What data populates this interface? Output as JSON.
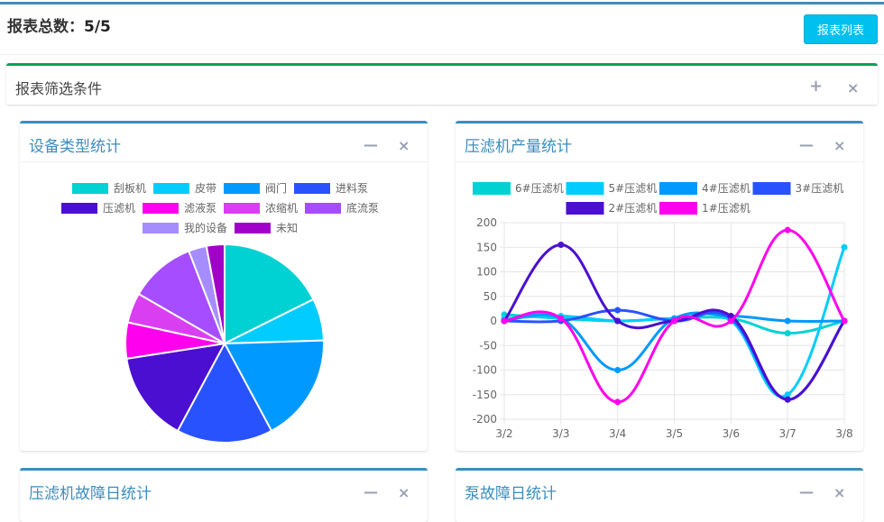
{
  "header": {
    "title_prefix": "报表总数：",
    "count": "5/5",
    "list_button": "报表列表"
  },
  "filter": {
    "title": "报表筛选条件",
    "expand_symbol": "+",
    "close_symbol": "×"
  },
  "panels": {
    "device_type": {
      "title": "设备类型统计",
      "minimize_symbol": "—",
      "close_symbol": "×"
    },
    "press_output": {
      "title": "压滤机产量统计",
      "minimize_symbol": "—",
      "close_symbol": "×"
    },
    "press_fault": {
      "title": "压滤机故障日统计",
      "minimize_symbol": "—",
      "close_symbol": "×"
    },
    "pump_fault": {
      "title": "泵故障日统计",
      "minimize_symbol": "—",
      "close_symbol": "×"
    }
  },
  "chart_data": [
    {
      "type": "pie",
      "labels": [
        "刮板机",
        "皮带",
        "阀门",
        "进料泵",
        "压滤机",
        "滤液泵",
        "浓缩机",
        "底流泵",
        "我的设备",
        "未知"
      ],
      "values": [
        18,
        7,
        18,
        16,
        15,
        6,
        5,
        11,
        3,
        3
      ],
      "colors": [
        "#00d2d3",
        "#00ccff",
        "#0099ff",
        "#2952ff",
        "#4b0fd2",
        "#ff00ee",
        "#d93ff0",
        "#a64dff",
        "#a58cff",
        "#a000c8"
      ],
      "legend": "top"
    },
    {
      "type": "line",
      "x": [
        "3/2",
        "3/3",
        "3/4",
        "3/5",
        "3/6",
        "3/7",
        "3/8"
      ],
      "ylim": [
        -200,
        200
      ],
      "yticks": [
        200,
        150,
        100,
        50,
        0,
        -50,
        -100,
        -150,
        -200
      ],
      "legend": "top",
      "grid": true,
      "series": [
        {
          "name": "6#压滤机",
          "color": "#00d2d3",
          "values": [
            13,
            5,
            0,
            5,
            5,
            -25,
            0
          ]
        },
        {
          "name": "5#压滤机",
          "color": "#00ccff",
          "values": [
            5,
            10,
            0,
            5,
            0,
            -150,
            150
          ]
        },
        {
          "name": "4#压滤机",
          "color": "#0099ff",
          "values": [
            0,
            5,
            -100,
            5,
            10,
            0,
            0
          ]
        },
        {
          "name": "3#压滤机",
          "color": "#2952ff",
          "values": [
            0,
            0,
            22,
            0,
            5,
            -160,
            0
          ]
        },
        {
          "name": "2#压滤机",
          "color": "#4b0fd2",
          "values": [
            0,
            155,
            0,
            0,
            10,
            -160,
            0
          ]
        },
        {
          "name": "1#压滤机",
          "color": "#ff00ee",
          "values": [
            0,
            5,
            -165,
            0,
            0,
            185,
            0
          ]
        }
      ]
    }
  ]
}
